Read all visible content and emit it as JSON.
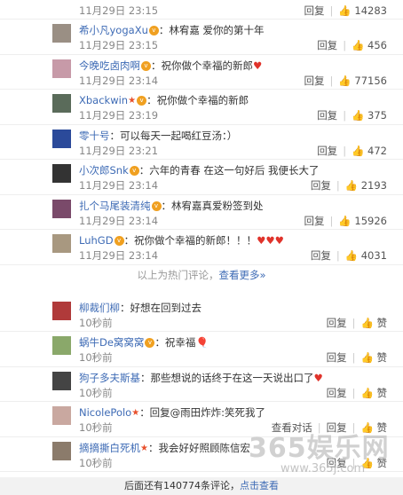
{
  "hot": [
    {
      "user": "",
      "badges": "",
      "text": "",
      "time": "11月29日 23:15",
      "reply": "回复",
      "likes": "14283",
      "avatar_color": "#777777"
    },
    {
      "user": "希小凡yogaXu",
      "badges": "v",
      "text": "：林宥嘉 爱你的第十年",
      "time": "11月29日 23:15",
      "reply": "回复",
      "likes": "456",
      "avatar_color": "#9a8f84"
    },
    {
      "user": "今晚吃卤肉啊",
      "badges": "v",
      "text": "：祝你做个幸福的新郎",
      "emoji": "♥",
      "time": "11月29日 23:14",
      "reply": "回复",
      "likes": "77156",
      "avatar_color": "#c79aa8"
    },
    {
      "user": "Xbackwin",
      "badges": "star v",
      "text": "：祝你做个幸福的新郎",
      "time": "11月29日 23:19",
      "reply": "回复",
      "likes": "375",
      "avatar_color": "#5a6b5a"
    },
    {
      "user": "零十号",
      "badges": "",
      "text": "：可以每天一起喝红豆汤：）",
      "time": "11月29日 23:21",
      "reply": "回复",
      "likes": "472",
      "avatar_color": "#2b4a9a"
    },
    {
      "user": "小次郎Snk",
      "badges": "v",
      "text": "：六年的青春 在这一句好后 我便长大了",
      "time": "11月29日 23:14",
      "reply": "回复",
      "likes": "2193",
      "avatar_color": "#333333"
    },
    {
      "user": "扎个马尾装清纯",
      "badges": "v",
      "text": "：林宥嘉真爱粉签到处",
      "time": "11月29日 23:14",
      "reply": "回复",
      "likes": "15926",
      "avatar_color": "#7a4a6a"
    },
    {
      "user": "LuhGD",
      "badges": "v",
      "text": "：祝你做个幸福的新郎！！！",
      "emoji": "♥♥♥",
      "time": "11月29日 23:14",
      "reply": "回复",
      "likes": "4031",
      "avatar_color": "#a89880"
    }
  ],
  "more_hot": {
    "prefix": "以上为热门评论，",
    "link": "查看更多",
    "suffix": "»"
  },
  "recent": [
    {
      "user": "柳裁们柳",
      "badges": "",
      "text": "：好想在回到过去",
      "time": "10秒前",
      "reply": "回复",
      "like_label": "赞",
      "avatar_color": "#b03a3a"
    },
    {
      "user": "蜗牛De窝窝窝",
      "badges": "v",
      "text": "：祝幸福",
      "emoji": "🎈",
      "time": "10秒前",
      "reply": "回复",
      "like_label": "赞",
      "avatar_color": "#8aa86a"
    },
    {
      "user": "狗子多夫斯基",
      "badges": "",
      "text": "：那些想说的话终于在这一天说出口了",
      "emoji": "♥",
      "time": "10秒前",
      "reply": "回复",
      "like_label": "赞",
      "avatar_color": "#444444"
    },
    {
      "user": "NicolePolo",
      "badges": "star",
      "text": "：回复@雨田炸炸:笑死我了",
      "time": "10秒前",
      "view_dialog": "查看对话",
      "reply": "回复",
      "like_label": "赞",
      "avatar_color": "#c9a8a0"
    },
    {
      "user": "摘摘撕白死机",
      "badges": "star",
      "text": "：我会好好照顾陈信宏",
      "time": "10秒前",
      "reply": "回复",
      "like_label": "赞",
      "avatar_color": "#8b7b6b"
    }
  ],
  "footer": {
    "prefix": "后面还有140774条评论，",
    "link": "点击查看"
  },
  "watermark": {
    "main": "365娱乐网",
    "sub": "www.365j.com"
  }
}
